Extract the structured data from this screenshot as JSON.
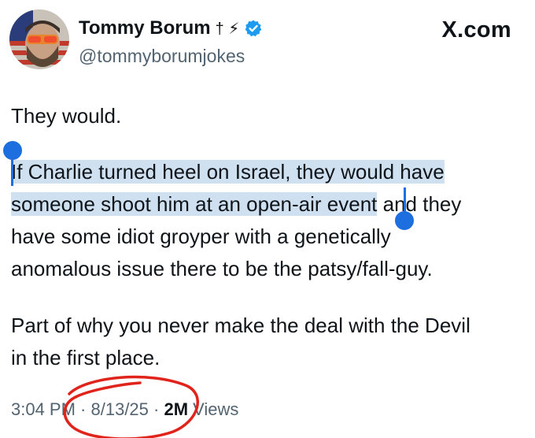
{
  "header": {
    "display_name": "Tommy Borum",
    "name_symbols": "† ⚡",
    "handle": "@tommyborumjokes",
    "brand": "X.com",
    "verified_icon": "verified-badge-icon"
  },
  "tweet": {
    "line1": "They would.",
    "para2": {
      "highlight_line1": "If Charlie turned heel on Israel, they would have",
      "highlight_line2": "someone shoot him at an open-air event",
      "rest_line2": " and they",
      "line3": "have some idiot groyper with a genetically",
      "line4": "anomalous issue there to be the patsy/fall-guy."
    },
    "para3_line1": "Part of why you never make the deal with the Devil",
    "para3_line2": "in the first place."
  },
  "meta": {
    "time": "3:04 PM",
    "sep": " · ",
    "date": "8/13/25",
    "views_count": "2M",
    "views_label": " Views"
  },
  "colors": {
    "selection": "#cfe0f0",
    "handle_blue": "#1d6fe0",
    "annotation_red": "#e0241c",
    "verified_blue": "#1d9bf0"
  }
}
